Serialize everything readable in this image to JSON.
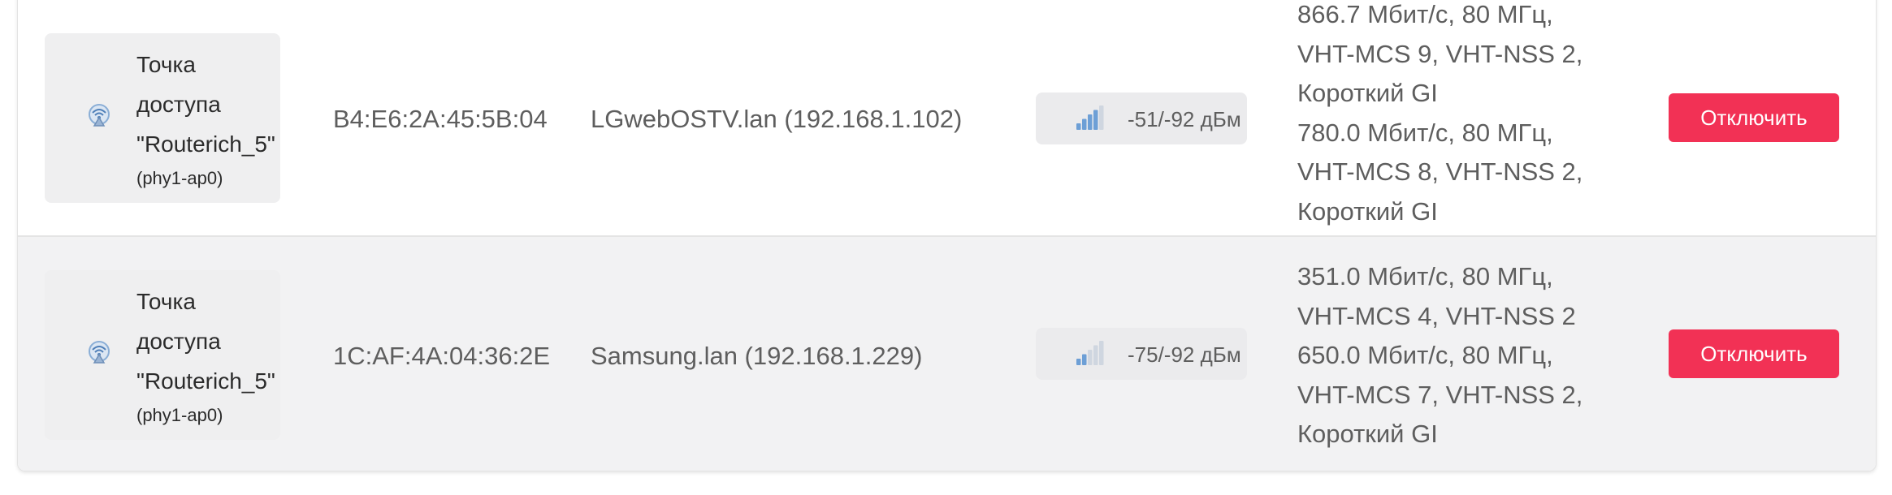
{
  "stations": [
    {
      "interface_name": "Точка доступа \"Routerich_5\"",
      "interface_device": "(phy1-ap0)",
      "interface_icon": "wifi-access-point-icon",
      "mac": "B4:E6:2A:45:5B:04",
      "host": "LGwebOSTV.lan (192.168.1.102)",
      "signal_icon": "signal-strength-icon",
      "signal_level": 0.8,
      "signal": "-51/-92 дБм",
      "rx_rate_lines": [
        "866.7 Мбит/с, 80 МГц,",
        "VHT-MCS 9, VHT-NSS 2,",
        "Короткий GI"
      ],
      "tx_rate_lines": [
        "780.0 Мбит/с, 80 МГц,",
        "VHT-MCS 8, VHT-NSS 2,",
        "Короткий GI"
      ],
      "disconnect_label": "Отключить"
    },
    {
      "interface_name": "Точка доступа \"Routerich_5\"",
      "interface_device": "(phy1-ap0)",
      "interface_icon": "wifi-access-point-icon",
      "mac": "1C:AF:4A:04:36:2E",
      "host": "Samsung.lan (192.168.1.229)",
      "signal_icon": "signal-strength-icon",
      "signal_level": 0.4,
      "signal": "-75/-92 дБм",
      "rx_rate_lines": [
        "351.0 Мбит/с, 80 МГц,",
        "VHT-MCS 4, VHT-NSS 2"
      ],
      "tx_rate_lines": [
        "650.0 Мбит/с, 80 МГц,",
        "VHT-MCS 7, VHT-NSS 2,",
        "Короткий GI"
      ],
      "disconnect_label": "Отключить"
    }
  ],
  "colors": {
    "disconnect_button": "#f23155",
    "signal_active": "#6d9fd6",
    "signal_inactive": "#cfd6e0",
    "alt_row": "#f2f2f3"
  }
}
